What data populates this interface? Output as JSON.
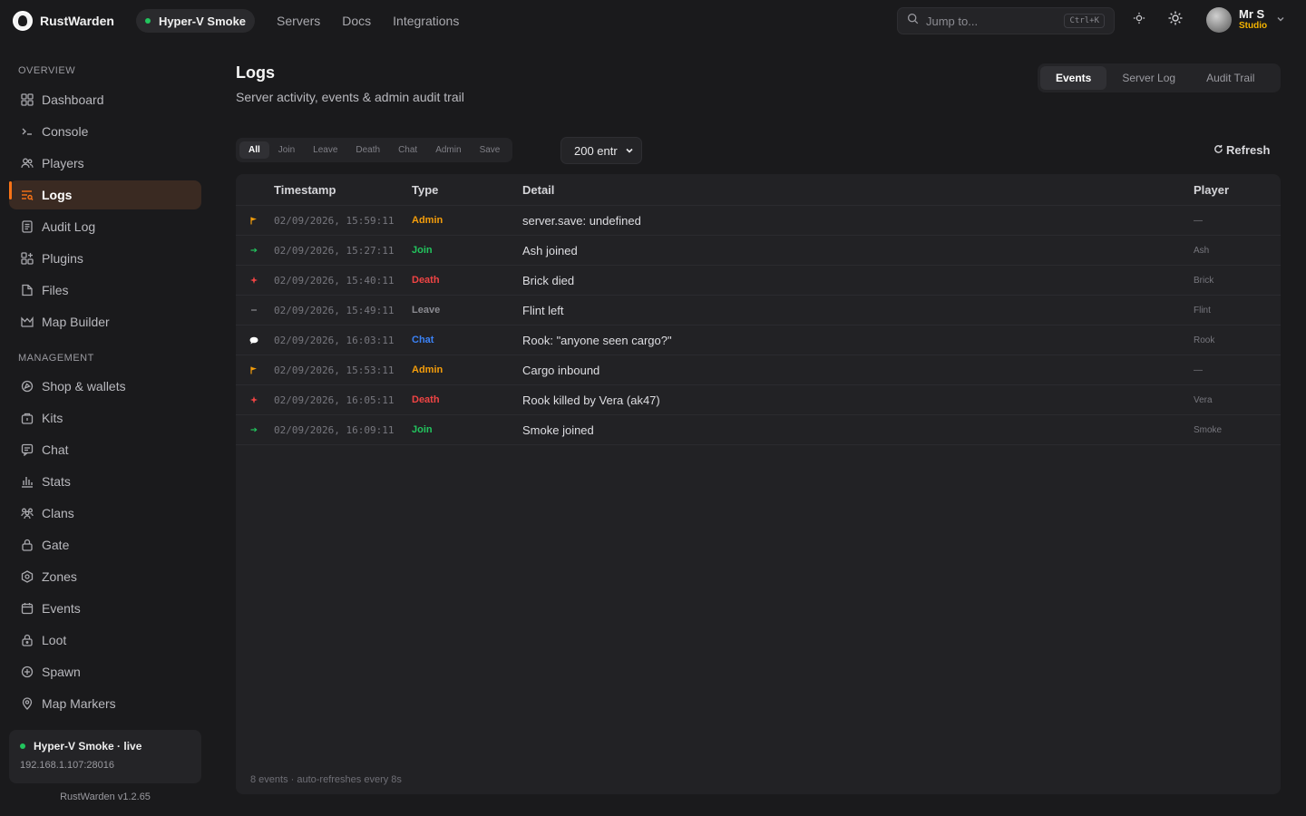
{
  "brand": {
    "name": "RustWarden"
  },
  "server_pill": {
    "label": "Hyper-V Smoke"
  },
  "topnav": [
    {
      "label": "Servers"
    },
    {
      "label": "Docs"
    },
    {
      "label": "Integrations"
    }
  ],
  "search": {
    "placeholder": "Jump to...",
    "shortcut": "Ctrl+K"
  },
  "user": {
    "name": "Mr S",
    "role": "Studio"
  },
  "sidebar": {
    "overview_label": "OVERVIEW",
    "management_label": "MANAGEMENT",
    "overview": [
      {
        "label": "Dashboard",
        "icon": "grid-icon"
      },
      {
        "label": "Console",
        "icon": "terminal-icon"
      },
      {
        "label": "Players",
        "icon": "users-icon"
      },
      {
        "label": "Logs",
        "icon": "logs-icon",
        "active": true
      },
      {
        "label": "Audit Log",
        "icon": "document-icon"
      },
      {
        "label": "Plugins",
        "icon": "plugins-icon"
      },
      {
        "label": "Files",
        "icon": "file-icon"
      },
      {
        "label": "Map Builder",
        "icon": "map-icon"
      }
    ],
    "management": [
      {
        "label": "Shop & wallets",
        "icon": "wallet-icon"
      },
      {
        "label": "Kits",
        "icon": "kit-icon"
      },
      {
        "label": "Chat",
        "icon": "chat-icon"
      },
      {
        "label": "Stats",
        "icon": "bar-chart-icon"
      },
      {
        "label": "Clans",
        "icon": "clans-icon"
      },
      {
        "label": "Gate",
        "icon": "lock-icon"
      },
      {
        "label": "Zones",
        "icon": "hexagon-icon"
      },
      {
        "label": "Events",
        "icon": "calendar-icon"
      },
      {
        "label": "Loot",
        "icon": "loot-lock-icon"
      },
      {
        "label": "Spawn",
        "icon": "plus-circle-icon"
      },
      {
        "label": "Map Markers",
        "icon": "pin-icon"
      }
    ],
    "status": {
      "title": "Hyper-V Smoke · live",
      "address": "192.168.1.107:28016"
    },
    "version": "RustWarden v1.2.65"
  },
  "page": {
    "title": "Logs",
    "subtitle": "Server activity, events & admin audit trail"
  },
  "view_tabs": [
    {
      "label": "Events",
      "active": true
    },
    {
      "label": "Server Log"
    },
    {
      "label": "Audit Trail"
    }
  ],
  "filters": [
    {
      "label": "All",
      "active": true
    },
    {
      "label": "Join"
    },
    {
      "label": "Leave"
    },
    {
      "label": "Death"
    },
    {
      "label": "Chat"
    },
    {
      "label": "Admin"
    },
    {
      "label": "Save"
    }
  ],
  "entries_select": {
    "value": "200 entr"
  },
  "refresh_label": "Refresh",
  "table": {
    "headers": {
      "timestamp": "Timestamp",
      "type": "Type",
      "detail": "Detail",
      "player": "Player"
    },
    "rows": [
      {
        "icon": "flag-icon",
        "timestamp": "02/09/2026, 15:59:11",
        "type": "Admin",
        "detail": "server.save: undefined",
        "player": "—"
      },
      {
        "icon": "arrow-right-icon",
        "timestamp": "02/09/2026, 15:27:11",
        "type": "Join",
        "detail": "Ash joined",
        "player": "Ash"
      },
      {
        "icon": "spark-icon",
        "timestamp": "02/09/2026, 15:40:11",
        "type": "Death",
        "detail": "Brick died",
        "player": "Brick"
      },
      {
        "icon": "dash-icon",
        "timestamp": "02/09/2026, 15:49:11",
        "type": "Leave",
        "detail": "Flint left",
        "player": "Flint"
      },
      {
        "icon": "speech-bubble-icon",
        "timestamp": "02/09/2026, 16:03:11",
        "type": "Chat",
        "detail": "Rook: \"anyone seen cargo?\"",
        "player": "Rook"
      },
      {
        "icon": "flag-icon",
        "timestamp": "02/09/2026, 15:53:11",
        "type": "Admin",
        "detail": "Cargo inbound",
        "player": "—"
      },
      {
        "icon": "spark-icon",
        "timestamp": "02/09/2026, 16:05:11",
        "type": "Death",
        "detail": "Rook killed by Vera (ak47)",
        "player": "Vera"
      },
      {
        "icon": "arrow-right-icon",
        "timestamp": "02/09/2026, 16:09:11",
        "type": "Join",
        "detail": "Smoke joined",
        "player": "Smoke"
      }
    ],
    "footnote": "8 events · auto-refreshes every 8s"
  },
  "colors": {
    "accent": "#f97316",
    "admin": "#f59e0b",
    "join": "#22c55e",
    "death": "#ef4444",
    "leave": "#8a8a90",
    "chat": "#3b82f6",
    "role": "#f5b400"
  }
}
